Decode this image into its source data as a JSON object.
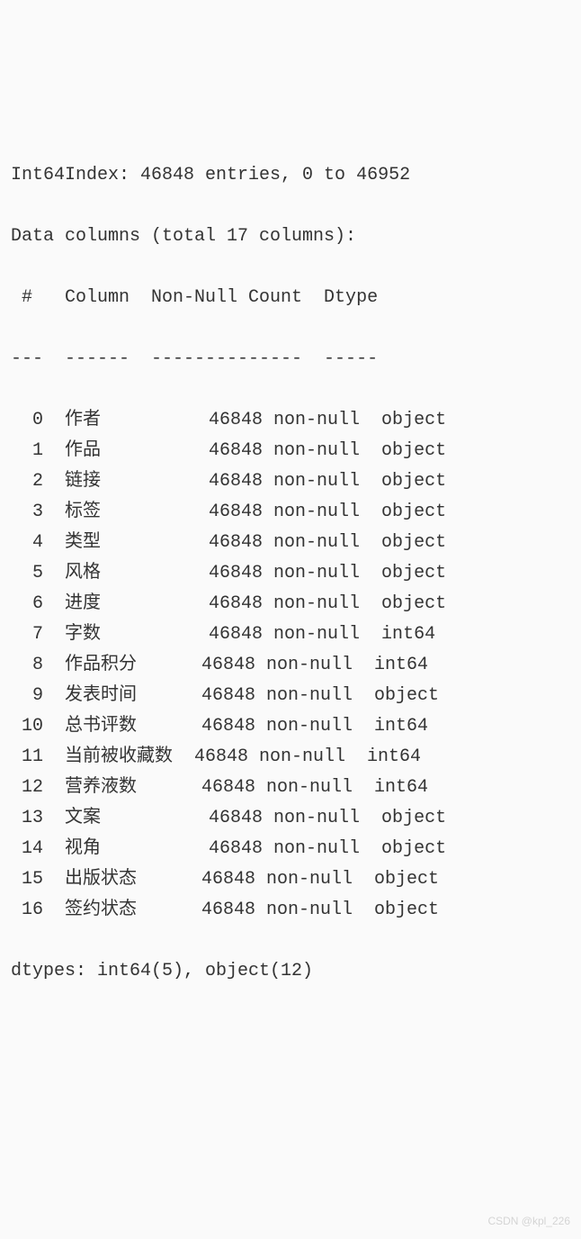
{
  "header": {
    "index_line": "Int64Index: 46848 entries, 0 to 46952",
    "columns_line": "Data columns (total 17 columns):",
    "table_header": " #   Column  Non-Null Count  Dtype",
    "separator": "---  ------  --------------  -----"
  },
  "rows": [
    {
      "idx": "0",
      "col": "作者",
      "count": "46848 non-null",
      "dtype": "object"
    },
    {
      "idx": "1",
      "col": "作品",
      "count": "46848 non-null",
      "dtype": "object"
    },
    {
      "idx": "2",
      "col": "链接",
      "count": "46848 non-null",
      "dtype": "object"
    },
    {
      "idx": "3",
      "col": "标签",
      "count": "46848 non-null",
      "dtype": "object"
    },
    {
      "idx": "4",
      "col": "类型",
      "count": "46848 non-null",
      "dtype": "object"
    },
    {
      "idx": "5",
      "col": "风格",
      "count": "46848 non-null",
      "dtype": "object"
    },
    {
      "idx": "6",
      "col": "进度",
      "count": "46848 non-null",
      "dtype": "object"
    },
    {
      "idx": "7",
      "col": "字数",
      "count": "46848 non-null",
      "dtype": "int64"
    },
    {
      "idx": "8",
      "col": "作品积分",
      "count": "46848 non-null",
      "dtype": "int64"
    },
    {
      "idx": "9",
      "col": "发表时间",
      "count": "46848 non-null",
      "dtype": "object"
    },
    {
      "idx": "10",
      "col": "总书评数",
      "count": "46848 non-null",
      "dtype": "int64"
    },
    {
      "idx": "11",
      "col": "当前被收藏数",
      "count": "46848 non-null",
      "dtype": "int64"
    },
    {
      "idx": "12",
      "col": "营养液数",
      "count": "46848 non-null",
      "dtype": "int64"
    },
    {
      "idx": "13",
      "col": "文案",
      "count": "46848 non-null",
      "dtype": "object"
    },
    {
      "idx": "14",
      "col": "视角",
      "count": "46848 non-null",
      "dtype": "object"
    },
    {
      "idx": "15",
      "col": "出版状态",
      "count": "46848 non-null",
      "dtype": "object"
    },
    {
      "idx": "16",
      "col": "签约状态",
      "count": "46848 non-null",
      "dtype": "object"
    }
  ],
  "footer": {
    "dtypes_line": "dtypes: int64(5), object(12)"
  },
  "watermark": "CSDN @kpl_226"
}
